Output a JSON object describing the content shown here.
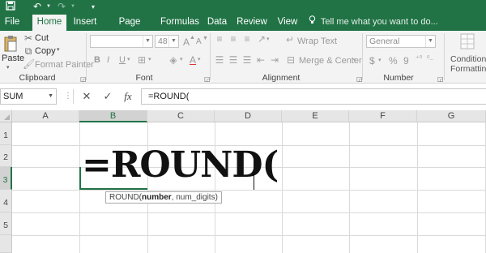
{
  "tabs": [
    "File",
    "Home",
    "Insert",
    "Page Layout",
    "Formulas",
    "Data",
    "Review",
    "View"
  ],
  "active_tab": "Home",
  "tell_me": "Tell me what you want to do...",
  "clipboard": {
    "paste": "Paste",
    "cut": "Cut",
    "copy": "Copy",
    "format_painter": "Format Painter",
    "label": "Clipboard"
  },
  "font": {
    "size": "48",
    "bold": "B",
    "italic": "I",
    "underline": "U",
    "grow": "A",
    "shrink": "A",
    "font_color": "A",
    "label": "Font"
  },
  "alignment": {
    "wrap_text": "Wrap Text",
    "merge_center": "Merge & Center",
    "label": "Alignment"
  },
  "number": {
    "format": "General",
    "currency": "$",
    "percent": "%",
    "comma": "9",
    "label": "Number"
  },
  "styles": {
    "conditional_formatting_line1": "Conditional",
    "conditional_formatting_line2": "Formatting"
  },
  "formula_bar": {
    "name_box": "SUM",
    "formula": "=ROUND(",
    "cancel": "✕",
    "enter": "✓",
    "fx": "fx"
  },
  "sheet": {
    "columns": [
      "A",
      "B",
      "C",
      "D",
      "E",
      "F",
      "G"
    ],
    "rows": [
      "1",
      "2",
      "3",
      "4",
      "5"
    ],
    "selected_column": "B",
    "selected_row": "3",
    "cell_entry": "=ROUND(",
    "tooltip": {
      "fn": "ROUND(",
      "arg_bold": "number",
      "rest": ", num_digits)"
    }
  },
  "colors": {
    "accent": "#217346",
    "ribbon": "#f3f3f3",
    "header": "#e6e6e6"
  },
  "icons": [
    "save-icon",
    "undo-icon",
    "redo-icon",
    "customize-qat-icon",
    "lightbulb-icon",
    "cut-icon",
    "copy-icon",
    "format-painter-icon",
    "paste-icon"
  ]
}
